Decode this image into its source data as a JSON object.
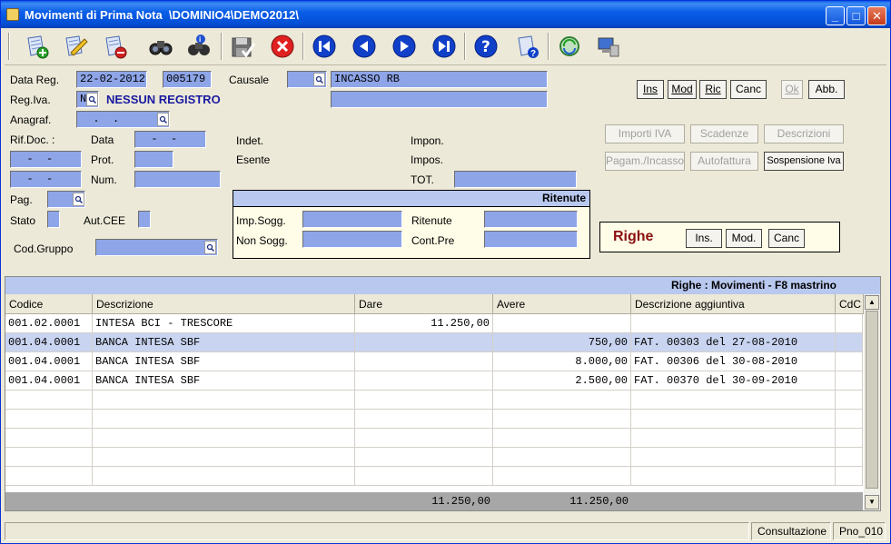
{
  "window": {
    "title": "Movimenti di Prima Nota  \\DOMINIO4\\DEMO2012\\",
    "minimize": "_",
    "maximize": "□",
    "close": "✕"
  },
  "toolbar": {
    "icons": [
      "add-record-icon",
      "edit-record-icon",
      "delete-record-icon",
      "search-icon",
      "search-info-icon",
      "save-icon",
      "cancel-icon",
      "first-record-icon",
      "previous-record-icon",
      "next-record-icon",
      "last-record-icon",
      "help-icon",
      "help-document-icon",
      "refresh-icon",
      "computer-icon"
    ]
  },
  "form": {
    "data_reg_label": "Data Reg.",
    "data_reg_value": "22-02-2012",
    "numero_value": "005179",
    "causale_label": "Causale",
    "causale_code": "",
    "causale_desc": "INCASSO RB",
    "causale_desc2": "",
    "reg_iva_label": "Reg.Iva.",
    "reg_iva_value": "N",
    "registro_text": "NESSUN REGISTRO",
    "anagraf_label": "Anagraf.",
    "anagraf_value": "  .  .",
    "rif_doc_label": "Rif.Doc. :",
    "data_label": "Data",
    "data_value": "  -  -",
    "rif_doc_1": "  -  -",
    "rif_doc_2": "  -  -",
    "prot_label": "Prot.",
    "num_label": "Num.",
    "pag_label": "Pag.",
    "stato_label": "Stato",
    "aut_cee_label": "Aut.CEE",
    "cod_gruppo_label": "Cod.Gruppo",
    "indet_label": "Indet.",
    "esente_label": "Esente",
    "impon_label": "Impon.",
    "impos_label": "Impos.",
    "tot_label": "TOT."
  },
  "buttons": {
    "ins": "Ins",
    "mod": "Mod",
    "ric": "Ric",
    "canc": "Canc",
    "ok": "Ok",
    "abb": "Abb.",
    "importi_iva": "Importi IVA",
    "scadenze": "Scadenze",
    "descrizioni": "Descrizioni",
    "pagam_incasso": "Pagam./Incasso",
    "autofattura": "Autofattura",
    "sospensione_iva": "Sospensione Iva"
  },
  "ritenute": {
    "title": "Ritenute",
    "imp_sogg_label": "Imp.Sogg.",
    "non_sogg_label": "Non Sogg.",
    "ritenute_label": "Ritenute",
    "cont_pre_label": "Cont.Pre"
  },
  "righe_panel": {
    "title": "Righe",
    "ins": "Ins.",
    "mod": "Mod.",
    "canc": "Canc"
  },
  "grid": {
    "title": "Righe : Movimenti - F8 mastrino",
    "columns": [
      "Codice",
      "Descrizione",
      "Dare",
      "Avere",
      "Descrizione aggiuntiva",
      "CdC"
    ],
    "rows": [
      {
        "codice": "001.02.0001",
        "descrizione": "INTESA BCI - TRESCORE",
        "dare": "11.250,00",
        "avere": "",
        "desc_agg": "",
        "cdc": ""
      },
      {
        "codice": "001.04.0001",
        "descrizione": "BANCA INTESA SBF",
        "dare": "",
        "avere": "750,00",
        "desc_agg": "FAT. 00303 del 27-08-2010",
        "cdc": ""
      },
      {
        "codice": "001.04.0001",
        "descrizione": "BANCA INTESA SBF",
        "dare": "",
        "avere": "8.000,00",
        "desc_agg": "FAT. 00306 del 30-08-2010",
        "cdc": ""
      },
      {
        "codice": "001.04.0001",
        "descrizione": "BANCA INTESA SBF",
        "dare": "",
        "avere": "2.500,00",
        "desc_agg": "FAT. 00370 del 30-09-2010",
        "cdc": ""
      }
    ],
    "total_dare": "11.250,00",
    "total_avere": "11.250,00"
  },
  "status": {
    "mode": "Consultazione",
    "form_id": "Pno_010"
  },
  "colors": {
    "field_bg": "#8ea5e8",
    "selected_row": "#c8d4f0",
    "registro_text": "#1a1aa0",
    "righe_title": "#8b1010"
  }
}
